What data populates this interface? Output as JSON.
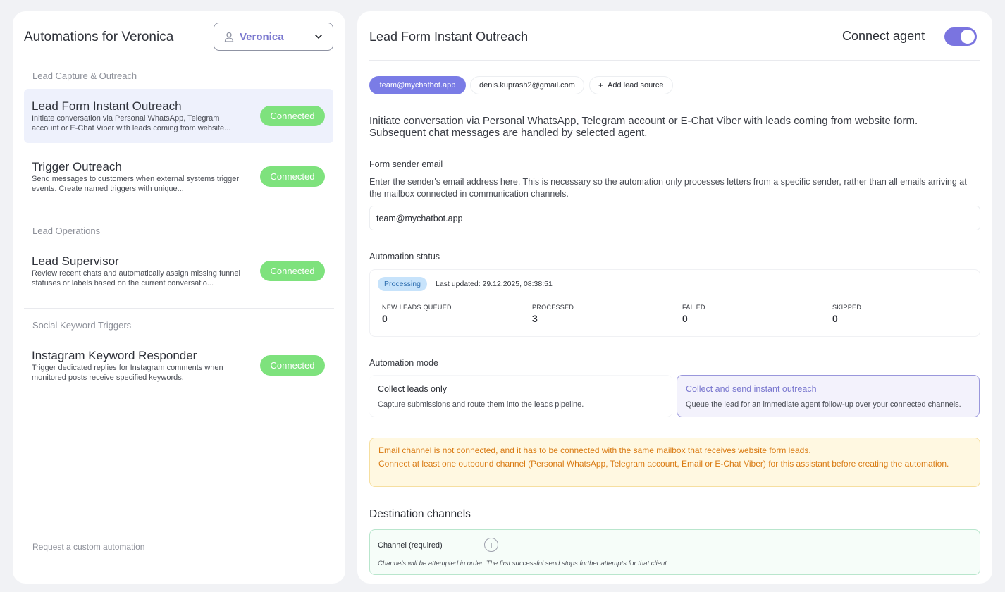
{
  "sidebar": {
    "title": "Automations for Veronica",
    "agent_select": {
      "value": "Veronica"
    },
    "groups": [
      {
        "title": "Lead Capture & Outreach",
        "items": [
          {
            "name": "Lead Form Instant Outreach",
            "desc": "Initiate conversation via Personal WhatsApp, Telegram account or E-Chat Viber with leads coming from website...",
            "status": "Connected",
            "active": true
          },
          {
            "name": "Trigger Outreach",
            "desc": "Send messages to customers when external systems trigger events. Create named triggers with unique...",
            "status": "Connected",
            "active": false
          }
        ]
      },
      {
        "title": "Lead Operations",
        "items": [
          {
            "name": "Lead Supervisor",
            "desc": "Review recent chats and automatically assign missing funnel statuses or labels based on the current conversatio...",
            "status": "Connected",
            "active": false
          }
        ]
      },
      {
        "title": "Social Keyword Triggers",
        "items": [
          {
            "name": "Instagram Keyword Responder",
            "desc": "Trigger dedicated replies for Instagram comments when monitored posts receive specified keywords.",
            "status": "Connected",
            "active": false
          }
        ]
      }
    ],
    "custom_link": "Request a custom automation"
  },
  "main": {
    "title": "Lead Form Instant Outreach",
    "connect_label": "Connect agent",
    "connect_on": true,
    "sources": [
      {
        "label": "team@mychatbot.app",
        "selected": true
      },
      {
        "label": "denis.kuprash2@gmail.com",
        "selected": false
      }
    ],
    "add_source_label": "Add lead source",
    "intro": "Initiate conversation via Personal WhatsApp, Telegram account or E-Chat Viber with leads coming from website form. Subsequent chat messages are handled by selected agent.",
    "sender": {
      "label": "Form sender email",
      "help": "Enter the sender's email address here. This is necessary so the automation only processes letters from a specific sender, rather than all emails arriving at the mailbox connected in communication channels.",
      "value": "team@mychatbot.app"
    },
    "status": {
      "label": "Automation status",
      "badge": "Processing",
      "updated": "Last updated: 29.12.2025, 08:38:51",
      "stats": [
        {
          "key": "NEW LEADS QUEUED",
          "value": "0"
        },
        {
          "key": "PROCESSED",
          "value": "3"
        },
        {
          "key": "FAILED",
          "value": "0"
        },
        {
          "key": "SKIPPED",
          "value": "0"
        }
      ]
    },
    "mode": {
      "label": "Automation mode",
      "options": [
        {
          "title": "Collect leads only",
          "desc": "Capture submissions and route them into the leads pipeline.",
          "selected": false
        },
        {
          "title": "Collect and send instant outreach",
          "desc": "Queue the lead for an immediate agent follow-up over your connected channels.",
          "selected": true
        }
      ]
    },
    "warnings": [
      "Email channel is not connected, and it has to be connected with the same mailbox that receives website form leads.",
      "Connect at least one outbound channel (Personal WhatsApp, Telegram account, Email or E-Chat Viber) for this assistant before creating the automation."
    ],
    "destination": {
      "title": "Destination channels",
      "channel_label": "Channel (required)",
      "hint": "Channels will be attempted in order. The first successful send stops further attempts for that client."
    }
  }
}
